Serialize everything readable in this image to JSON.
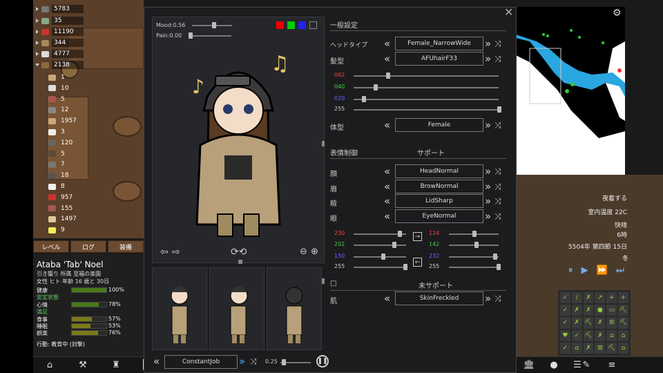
{
  "resources": [
    {
      "value": "5783",
      "color": "#777"
    },
    {
      "value": "35",
      "color": "#8a8"
    },
    {
      "value": "11190",
      "color": "#c33"
    },
    {
      "value": "344",
      "color": "#a88a5a"
    },
    {
      "value": "4777",
      "color": "#ddd"
    },
    {
      "value": "2138",
      "color": "#8a6a3a"
    }
  ],
  "sub_resources": [
    "1",
    "10",
    "5",
    "12",
    "1957",
    "3",
    "120",
    "5",
    "7",
    "18",
    "8",
    "957",
    "155",
    "1497",
    "9"
  ],
  "char_tabs": [
    "レベル",
    "ログ",
    "装備"
  ],
  "character": {
    "name": "Ataba 'Tab' Noel",
    "line1": "引き籠り  所属 至福の楽園",
    "line2": "女性 ヒト 年齢 16 歳と 30日",
    "needs": [
      {
        "label": "健康",
        "pct": "100%",
        "fill": 1.0,
        "sub": "安定状態"
      },
      {
        "label": "心情",
        "pct": "78%",
        "fill": 0.78,
        "sub": "満足"
      },
      {
        "label": "食事",
        "pct": "57%",
        "fill": 0.57
      },
      {
        "label": "睡眠",
        "pct": "53%",
        "fill": 0.53
      },
      {
        "label": "娯楽",
        "pct": "76%",
        "fill": 0.76
      }
    ],
    "action": "行動: 教育中 (封撃)"
  },
  "portrait": {
    "mood_label": "Mood:0.56",
    "mood": 0.56,
    "pain_label": "Pain:0.00",
    "pain": 0.0
  },
  "colors": {
    "red": "#e00",
    "green": "#0c0",
    "blue": "#22e"
  },
  "bottom_controls": {
    "job": "ConstantJob",
    "speed": "0.25"
  },
  "settings": {
    "general_header": "一般設定",
    "head_type_label": "ヘッドタイプ",
    "head_type_value": "Female_NarrowWide",
    "hair_label": "髪型",
    "hair_value": "AFUhairF33",
    "rgb": [
      {
        "value": "062",
        "color": "#e44",
        "fill": 0.24
      },
      {
        "value": "040",
        "color": "#4c4",
        "fill": 0.16
      },
      {
        "value": "020",
        "color": "#66f",
        "fill": 0.08
      },
      {
        "value": "255",
        "color": "#ccc",
        "fill": 1.0
      }
    ],
    "body_label": "体型",
    "body_value": "Female",
    "face_header": "表情制御",
    "support_header": "サポート",
    "face_rows": [
      {
        "label": "顔",
        "value": "HeadNormal"
      },
      {
        "label": "眉",
        "value": "BrowNormal"
      },
      {
        "label": "瞼",
        "value": "LidSharp"
      },
      {
        "label": "眼",
        "value": "EyeNormal"
      }
    ],
    "eye_rgb_left": [
      {
        "value": "230",
        "color": "#e44",
        "fill": 0.9
      },
      {
        "value": "202",
        "color": "#4c4",
        "fill": 0.79
      },
      {
        "value": "150",
        "color": "#66f",
        "fill": 0.59
      },
      {
        "value": "255",
        "color": "#ccc",
        "fill": 1.0
      }
    ],
    "eye_rgb_right": [
      {
        "value": "124",
        "color": "#e44",
        "fill": 0.49
      },
      {
        "value": "142",
        "color": "#4c4",
        "fill": 0.56
      },
      {
        "value": "232",
        "color": "#66f",
        "fill": 0.91
      },
      {
        "value": "255",
        "color": "#ccc",
        "fill": 1.0
      }
    ],
    "unsupported_header": "未サポート",
    "skin_label": "肌",
    "skin_value": "SkinFreckled"
  },
  "right_info": {
    "dress": "夜着する",
    "temp": "室内温度 22C",
    "weather": "快晴",
    "hour": "6時",
    "date": "5504年 第四節 15日",
    "season": "冬"
  }
}
